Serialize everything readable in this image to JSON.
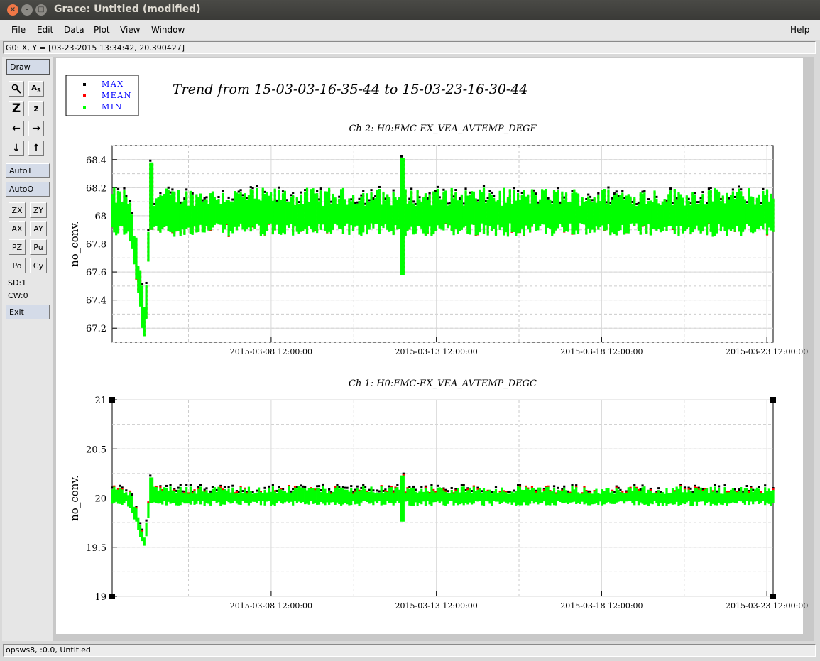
{
  "window": {
    "title": "Grace: Untitled (modified)"
  },
  "menu": {
    "file": "File",
    "edit": "Edit",
    "data": "Data",
    "plot": "Plot",
    "view": "View",
    "window": "Window",
    "help": "Help"
  },
  "locator": "G0: X, Y = [03-23-2015 13:34:42, 20.390427]",
  "toolbar": {
    "draw": "Draw",
    "autot": "AutoT",
    "autoo": "AutoO",
    "zx": "ZX",
    "zy": "ZY",
    "ax": "AX",
    "ay": "AY",
    "pz": "PZ",
    "pu": "Pu",
    "po": "Po",
    "cy": "Cy",
    "sd": "SD:1",
    "cw": "CW:0",
    "exit": "Exit"
  },
  "status": "opsws8, :0.0, Untitled",
  "colors": {
    "max": "#000000",
    "mean": "#ff0000",
    "min": "#00ff00",
    "legend_text": "#0000ff"
  },
  "chart_data": {
    "type": "scatter",
    "title": "Trend from 15-03-03-16-35-44 to 15-03-23-16-30-44",
    "legend": {
      "placement": "top-left",
      "entries": [
        "MAX",
        "MEAN",
        "MIN"
      ]
    },
    "x_ticks": [
      "2015-03-08 12:00:00",
      "2015-03-13 12:00:00",
      "2015-03-18 12:00:00",
      "2015-03-23 12:00:00"
    ],
    "xlim": [
      "2015-03-03 16:35:44",
      "2015-03-23 16:30:44"
    ],
    "grid": true,
    "panels": [
      {
        "subtitle": "Ch 2: H0:FMC-EX_VEA_AVTEMP_DEGF",
        "ylabel": "no_conv.",
        "ylim": [
          67.1,
          68.5
        ],
        "y_ticks": [
          "68.4",
          "68.2",
          "68",
          "67.8",
          "67.6",
          "67.4",
          "67.2"
        ],
        "baseline": 68.0,
        "dip": {
          "day": 1.0,
          "min": 67.15
        },
        "spikes": [
          {
            "day": 8.8,
            "max": 68.41,
            "min": 67.58
          },
          {
            "day": 1.2,
            "max": 68.38,
            "min": 67.9
          }
        ],
        "band_max": 68.2,
        "band_min": 67.85
      },
      {
        "subtitle": "Ch 1: H0:FMC-EX_VEA_AVTEMP_DEGC",
        "ylabel": "no_conv.",
        "ylim": [
          19,
          21
        ],
        "y_ticks": [
          "21",
          "20.5",
          "20",
          "19.5",
          "19"
        ],
        "baseline": 20.0,
        "dip": {
          "day": 1.0,
          "min": 19.52
        },
        "spikes": [
          {
            "day": 8.8,
            "max": 20.23,
            "min": 19.76
          },
          {
            "day": 1.2,
            "max": 20.21,
            "min": 19.95
          }
        ],
        "band_max": 20.12,
        "band_min": 19.92
      }
    ]
  }
}
